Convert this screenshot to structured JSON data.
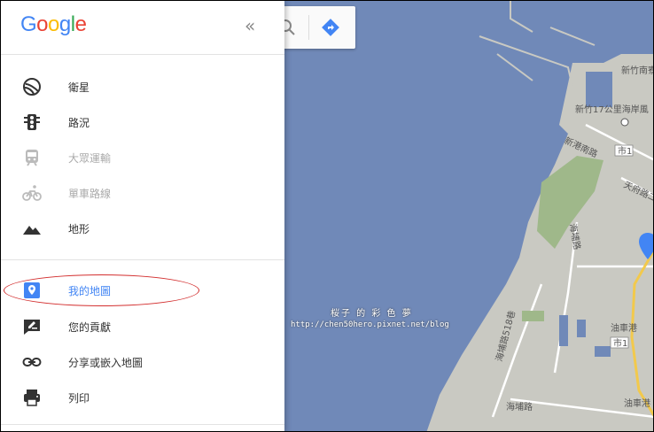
{
  "logo": {
    "text": "Google",
    "letters": [
      {
        "ch": "G",
        "color": "#4285f4"
      },
      {
        "ch": "o",
        "color": "#ea4335"
      },
      {
        "ch": "o",
        "color": "#fbbc05"
      },
      {
        "ch": "g",
        "color": "#4285f4"
      },
      {
        "ch": "l",
        "color": "#34a853"
      },
      {
        "ch": "e",
        "color": "#ea4335"
      }
    ]
  },
  "sidebar": {
    "collapse_label": "«",
    "layers": [
      {
        "label": "衛星",
        "icon": "satellite-icon"
      },
      {
        "label": "路況",
        "icon": "traffic-light-icon"
      },
      {
        "label": "大眾運輸",
        "icon": "train-icon",
        "disabled": true
      },
      {
        "label": "單車路線",
        "icon": "bicycle-icon",
        "disabled": true
      },
      {
        "label": "地形",
        "icon": "mountain-icon"
      }
    ],
    "actions": [
      {
        "label": "我的地圖",
        "icon": "map-pin-icon",
        "active": true
      },
      {
        "label": "您的貢獻",
        "icon": "edit-icon"
      },
      {
        "label": "分享或嵌入地圖",
        "icon": "link-icon"
      },
      {
        "label": "列印",
        "icon": "printer-icon"
      }
    ]
  },
  "map": {
    "colors": {
      "water": "#7089b8",
      "land": "#c9c9c2",
      "green": "#9fb88a"
    },
    "labels": {
      "hsinchu_south": "新竹南寮",
      "coastal_park": "新竹17公里海岸風",
      "xingang_road": "新港南路",
      "city_road_1": "市1",
      "city_road_1b": "市1",
      "tianfu_road": "天府路二",
      "haibin_road": "海埔路",
      "lane_518": "海埔路518巷",
      "youche_port": "油車港",
      "youche_port_2": "油車港",
      "haibin_road_2": "海埔路"
    }
  },
  "watermark": {
    "line1": "桜子 的 彩 色 夢",
    "line2": "http://chen50hero.pixnet.net/blog"
  }
}
